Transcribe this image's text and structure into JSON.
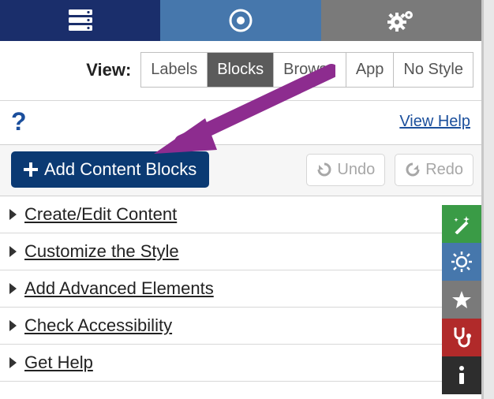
{
  "top_tabs": {
    "data": "data-tab",
    "target": "target-tab",
    "settings": "settings-tab"
  },
  "view": {
    "label": "View:",
    "options": [
      "Labels",
      "Blocks",
      "Browse",
      "App",
      "No Style"
    ],
    "active": "Blocks"
  },
  "help": {
    "icon": "?",
    "link": "View Help"
  },
  "actions": {
    "add": "Add Content Blocks",
    "undo": "Undo",
    "redo": "Redo"
  },
  "accordion": [
    "Create/Edit Content",
    "Customize the Style",
    "Add Advanced Elements",
    "Check Accessibility",
    "Get Help"
  ],
  "side": {
    "wand": "magic-wand",
    "sun": "brightness",
    "star": "star",
    "med": "stethoscope",
    "info": "info"
  }
}
